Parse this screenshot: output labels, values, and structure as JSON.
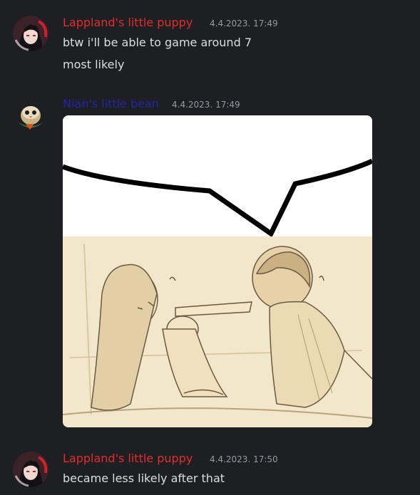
{
  "colors": {
    "background": "#1e1f22",
    "message_text": "#dbdee1",
    "timestamp": "#949ba4",
    "puppy_name": "#e12d2d",
    "bean_name": "#2125a8"
  },
  "messages": [
    {
      "author": "Lappland's little puppy",
      "timestamp": "4.4.2023. 17:49",
      "avatar_icon": "dark-haired-girl-avatar",
      "lines": [
        "btw i'll be able to game around 7",
        "most likely"
      ]
    },
    {
      "author": "Nian's little bean",
      "timestamp": "4.4.2023. 17:49",
      "avatar_icon": "owl-bird-avatar",
      "attachment": "sketch-image"
    },
    {
      "author": "Lappland's little puppy",
      "timestamp": "4.4.2023. 17:50",
      "avatar_icon": "dark-haired-girl-avatar",
      "lines": [
        "became less likely after that"
      ]
    }
  ]
}
